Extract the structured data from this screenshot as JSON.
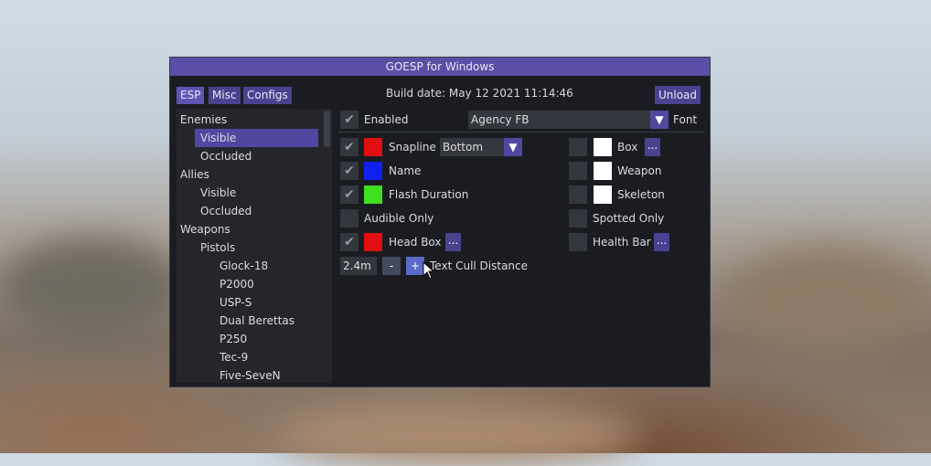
{
  "window": {
    "title": "GOESP for Windows"
  },
  "tabs": [
    {
      "label": "ESP",
      "active": true
    },
    {
      "label": "Misc",
      "active": false
    },
    {
      "label": "Configs",
      "active": false
    }
  ],
  "build_date": "Build date: May 12 2021 11:14:46",
  "unload_label": "Unload",
  "tree": {
    "enemies": "Enemies",
    "visible_1": "Visible",
    "occluded_1": "Occluded",
    "allies": "Allies",
    "visible_2": "Visible",
    "occluded_2": "Occluded",
    "weapons": "Weapons",
    "pistols": "Pistols",
    "glock": "Glock-18",
    "p2000": "P2000",
    "usps": "USP-S",
    "dual": "Dual Berettas",
    "p250": "P250",
    "tec9": "Tec-9",
    "fiveseven": "Five-SeveN"
  },
  "main": {
    "enabled_label": "Enabled",
    "font_value": "Agency FB",
    "font_label": "Font",
    "snapline_label": "Snapline",
    "snapline_value": "Bottom",
    "name_label": "Name",
    "flash_label": "Flash Duration",
    "audible_label": "Audible Only",
    "headbox_label": "Head Box",
    "box_label": "Box",
    "weapon_label": "Weapon",
    "skeleton_label": "Skeleton",
    "spotted_label": "Spotted Only",
    "healthbar_label": "Health Bar",
    "dots_label": "...",
    "cull_value": "2.4m",
    "cull_minus": "-",
    "cull_plus": "+",
    "cull_label": "Text Cull Distance"
  },
  "icons": {
    "check": "checkmark-icon",
    "arrow": "dropdown-arrow-icon",
    "cursor": "mouse-cursor-icon"
  },
  "colors": {
    "accent": "#5b4ea6",
    "snapline": "#e01010",
    "name": "#1020f0",
    "flash": "#40e020",
    "headbox": "#e01010",
    "white": "#ffffff"
  }
}
